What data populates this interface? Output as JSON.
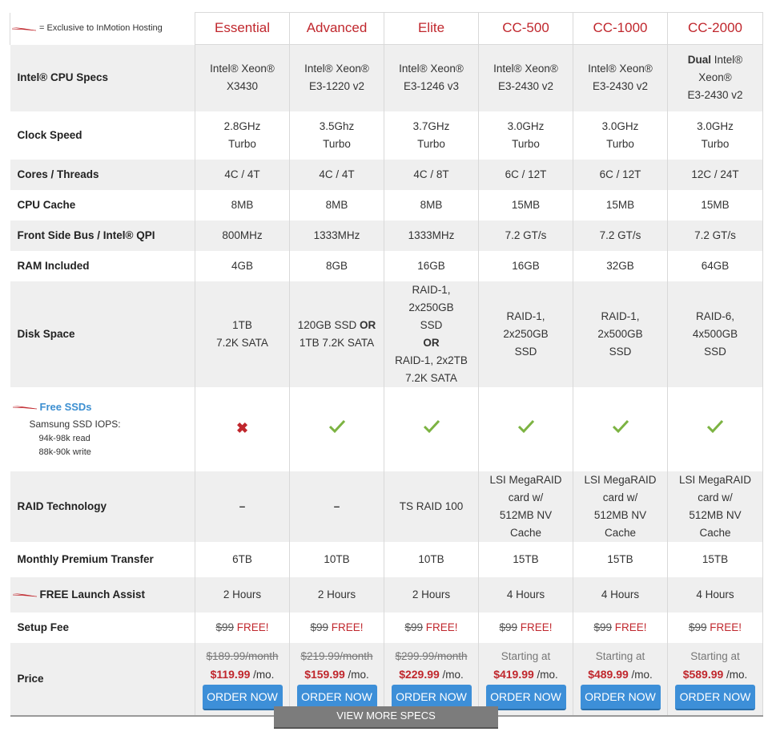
{
  "legend": {
    "text": "= Exclusive to InMotion Hosting"
  },
  "plans": [
    "Essential",
    "Advanced",
    "Elite",
    "CC-500",
    "CC-1000",
    "CC-2000"
  ],
  "rows": {
    "cpu": {
      "label": "Intel® CPU Specs",
      "cells": [
        {
          "l1": "Intel® Xeon®",
          "l2": "X3430"
        },
        {
          "l1": "Intel® Xeon®",
          "l2": "E3-1220 v2"
        },
        {
          "l1": "Intel® Xeon®",
          "l2": "E3-1246 v3"
        },
        {
          "l1": "Intel® Xeon®",
          "l2": "E3-2430 v2"
        },
        {
          "l1": "Intel® Xeon®",
          "l2": "E3-2430 v2"
        }
      ],
      "dual": {
        "bold": "Dual",
        "l1": " Intel®",
        "l2": "Xeon®",
        "l3": "E3-2430 v2"
      }
    },
    "clock": {
      "label": "Clock Speed",
      "cells": [
        {
          "l1": "2.8GHz",
          "l2": "Turbo"
        },
        {
          "l1": "3.5Ghz",
          "l2": "Turbo"
        },
        {
          "l1": "3.7GHz",
          "l2": "Turbo"
        },
        {
          "l1": "3.0GHz",
          "l2": "Turbo"
        },
        {
          "l1": "3.0GHz",
          "l2": "Turbo"
        },
        {
          "l1": "3.0GHz",
          "l2": "Turbo"
        }
      ]
    },
    "cores": {
      "label": "Cores / Threads",
      "values": [
        "4C / 4T",
        "4C / 4T",
        "4C / 8T",
        "6C / 12T",
        "6C / 12T",
        "12C / 24T"
      ]
    },
    "cache": {
      "label": "CPU Cache",
      "values": [
        "8MB",
        "8MB",
        "8MB",
        "15MB",
        "15MB",
        "15MB"
      ]
    },
    "fsb": {
      "label": "Front Side Bus / Intel® QPI",
      "values": [
        "800MHz",
        "1333MHz",
        "1333MHz",
        "7.2 GT/s",
        "7.2 GT/s",
        "7.2 GT/s"
      ]
    },
    "ram": {
      "label": "RAM Included",
      "values": [
        "4GB",
        "8GB",
        "16GB",
        "16GB",
        "32GB",
        "64GB"
      ]
    },
    "disk": {
      "label": "Disk Space",
      "essential": {
        "l1": "1TB",
        "l2": "7.2K SATA"
      },
      "advanced": {
        "a": "120GB SSD ",
        "or": "OR",
        "b": "1TB 7.2K SATA"
      },
      "elite": {
        "l1": "RAID-1, 2x250GB",
        "l2": "SSD",
        "or": "OR",
        "l3": "RAID-1, 2x2TB",
        "l4": "7.2K SATA"
      },
      "cc500": {
        "l1": "RAID-1, 2x250GB",
        "l2": "SSD"
      },
      "cc1000": {
        "l1": "RAID-1, 2x500GB",
        "l2": "SSD"
      },
      "cc2000": {
        "l1": "RAID-6, 4x500GB",
        "l2": "SSD"
      }
    },
    "ssd": {
      "title": "Free SSDs",
      "sub": "Samsung SSD IOPS:",
      "read": "94k-98k read",
      "write": "88k-90k write",
      "availability": [
        "x-icon",
        "check-icon",
        "check-icon",
        "check-icon",
        "check-icon",
        "check-icon"
      ]
    },
    "raid": {
      "label": "RAID Technology",
      "essential": "–",
      "advanced": "–",
      "elite": "TS RAID 100",
      "cc": {
        "l1": "LSI MegaRAID",
        "l2": "card w/",
        "l3": "512MB NV Cache"
      }
    },
    "transfer": {
      "label": "Monthly Premium Transfer",
      "values": [
        "6TB",
        "10TB",
        "10TB",
        "15TB",
        "15TB",
        "15TB"
      ]
    },
    "launch": {
      "label": "FREE Launch Assist",
      "values": [
        "2 Hours",
        "2 Hours",
        "2 Hours",
        "4 Hours",
        "4 Hours",
        "4 Hours"
      ]
    },
    "setup": {
      "label": "Setup Fee",
      "old": "$99",
      "free": " FREE!"
    },
    "price": {
      "label": "Price",
      "old": [
        "$189.99/month",
        "$219.99/month",
        "$299.99/month"
      ],
      "starting": "Starting at",
      "values": [
        "$119.99",
        "$159.99",
        "$229.99",
        "$419.99",
        "$489.99",
        "$589.99"
      ],
      "permo": " /mo.",
      "button": "ORDER NOW"
    }
  },
  "view_more": "VIEW MORE SPECS",
  "colors": {
    "accent_red": "#c0272d",
    "button_blue": "#3d8fd8",
    "check_green": "#7cb342",
    "alt_row": "#efefef",
    "ssd_blue": "#3c8fd1"
  }
}
